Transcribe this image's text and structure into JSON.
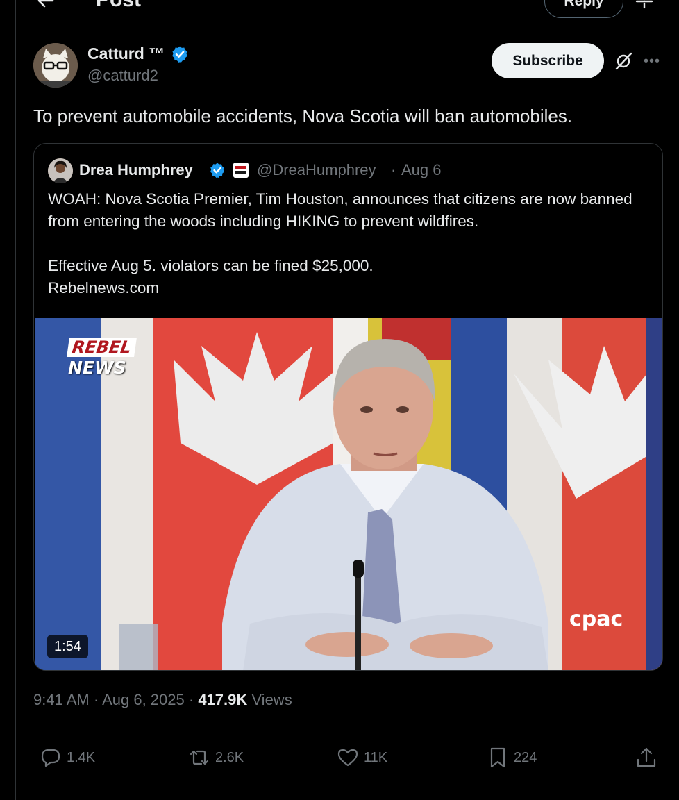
{
  "header": {
    "title": "Post",
    "reply_label": "Reply"
  },
  "author": {
    "name": "Catturd ™",
    "handle": "@catturd2",
    "subscribe_label": "Subscribe"
  },
  "post": {
    "text": "To prevent automobile accidents, Nova Scotia will ban automobiles."
  },
  "quoted": {
    "name": "Drea Humphrey",
    "handle": "@DreaHumphrey",
    "separator": "·",
    "date": "Aug 6",
    "line1": "WOAH: Nova Scotia Premier, Tim Houston, announces that citizens are now banned from entering the woods including HIKING to prevent wildfires.",
    "line2": "Effective Aug 5. violators can be fined $25,000.",
    "line3": "Rebelnews.com",
    "video": {
      "duration": "1:54",
      "watermark_line1": "REBEL",
      "watermark_line2": "NEWS",
      "broadcaster": "cpac"
    }
  },
  "meta": {
    "time": "9:41 AM",
    "sep1": "·",
    "date": "Aug 6, 2025",
    "sep2": "·",
    "views_count": "417.9K",
    "views_label": "Views"
  },
  "actions": {
    "replies": "1.4K",
    "reposts": "2.6K",
    "likes": "11K",
    "bookmarks": "224"
  },
  "icons": {
    "back": "arrow-left-icon",
    "expand": "expand-icon",
    "verified": "verified-badge-icon",
    "grok": "grok-icon",
    "more": "more-icon",
    "reply": "reply-icon",
    "repost": "repost-icon",
    "like": "heart-icon",
    "bookmark": "bookmark-icon",
    "share": "share-icon"
  },
  "colors": {
    "background": "#000000",
    "text_primary": "#e7e9ea",
    "text_secondary": "#71767b",
    "verified_blue": "#1d9bf0",
    "border": "#2f3336"
  }
}
